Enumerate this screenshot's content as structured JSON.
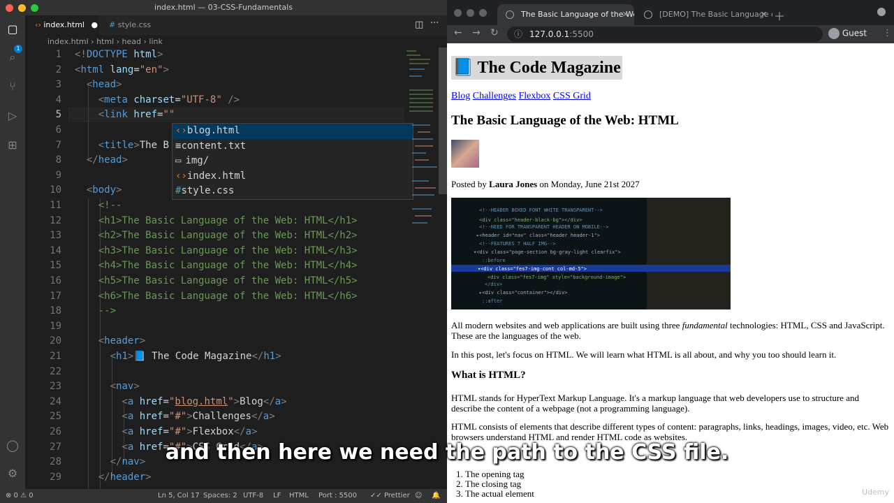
{
  "vscode": {
    "title": "index.html — 03-CSS-Fundamentals",
    "tabs": [
      {
        "label": "index.html",
        "modified": "●"
      },
      {
        "label": "style.css"
      }
    ],
    "breadcrumb": [
      "index.html",
      "html",
      "head",
      "link"
    ],
    "lines": [
      {
        "n": "1",
        "html": "<span class='p'>&lt;!</span><span class='k'>DOCTYPE</span> <span class='a'>html</span><span class='p'>&gt;</span>"
      },
      {
        "n": "2",
        "html": "<span class='p'>&lt;</span><span class='t'>html</span> <span class='a'>lang</span>=<span class='s'>\"en\"</span><span class='p'>&gt;</span>"
      },
      {
        "n": "3",
        "html": "  <span class='p'>&lt;</span><span class='t'>head</span><span class='p'>&gt;</span>"
      },
      {
        "n": "4",
        "html": "    <span class='p'>&lt;</span><span class='t'>meta</span> <span class='a'>charset</span>=<span class='s'>\"UTF-8\"</span> <span class='p'>/&gt;</span>"
      },
      {
        "n": "5",
        "html": "    <span class='p'>&lt;</span><span class='t'>link</span> <span class='a'>href</span>=<span class='s'>\"\"</span>"
      },
      {
        "n": "6",
        "html": ""
      },
      {
        "n": "7",
        "html": "    <span class='p'>&lt;</span><span class='t'>title</span><span class='p'>&gt;</span>The B"
      },
      {
        "n": "8",
        "html": "  <span class='p'>&lt;/</span><span class='t'>head</span><span class='p'>&gt;</span>"
      },
      {
        "n": "9",
        "html": ""
      },
      {
        "n": "10",
        "html": "  <span class='p'>&lt;</span><span class='t'>body</span><span class='p'>&gt;</span>"
      },
      {
        "n": "11",
        "html": "    <span class='c'>&lt;!--</span>"
      },
      {
        "n": "12",
        "html": "    <span class='c'>&lt;h1&gt;The Basic Language of the Web: HTML&lt;/h1&gt;</span>"
      },
      {
        "n": "13",
        "html": "    <span class='c'>&lt;h2&gt;The Basic Language of the Web: HTML&lt;/h2&gt;</span>"
      },
      {
        "n": "14",
        "html": "    <span class='c'>&lt;h3&gt;The Basic Language of the Web: HTML&lt;/h3&gt;</span>"
      },
      {
        "n": "15",
        "html": "    <span class='c'>&lt;h4&gt;The Basic Language of the Web: HTML&lt;/h4&gt;</span>"
      },
      {
        "n": "16",
        "html": "    <span class='c'>&lt;h5&gt;The Basic Language of the Web: HTML&lt;/h5&gt;</span>"
      },
      {
        "n": "17",
        "html": "    <span class='c'>&lt;h6&gt;The Basic Language of the Web: HTML&lt;/h6&gt;</span>"
      },
      {
        "n": "18",
        "html": "    <span class='c'>--&gt;</span>"
      },
      {
        "n": "19",
        "html": ""
      },
      {
        "n": "20",
        "html": "    <span class='p'>&lt;</span><span class='t'>header</span><span class='p'>&gt;</span>"
      },
      {
        "n": "21",
        "html": "      <span class='p'>&lt;</span><span class='t'>h1</span><span class='p'>&gt;</span>📘 The Code Magazine<span class='p'>&lt;/</span><span class='t'>h1</span><span class='p'>&gt;</span>"
      },
      {
        "n": "22",
        "html": ""
      },
      {
        "n": "23",
        "html": "      <span class='p'>&lt;</span><span class='t'>nav</span><span class='p'>&gt;</span>"
      },
      {
        "n": "24",
        "html": "        <span class='p'>&lt;</span><span class='t'>a</span> <span class='a'>href</span>=<span class='s'>\"<u>blog.html</u>\"</span><span class='p'>&gt;</span>Blog<span class='p'>&lt;/</span><span class='t'>a</span><span class='p'>&gt;</span>"
      },
      {
        "n": "25",
        "html": "        <span class='p'>&lt;</span><span class='t'>a</span> <span class='a'>href</span>=<span class='s'>\"#\"</span><span class='p'>&gt;</span>Challenges<span class='p'>&lt;/</span><span class='t'>a</span><span class='p'>&gt;</span>"
      },
      {
        "n": "26",
        "html": "        <span class='p'>&lt;</span><span class='t'>a</span> <span class='a'>href</span>=<span class='s'>\"#\"</span><span class='p'>&gt;</span>Flexbox<span class='p'>&lt;/</span><span class='t'>a</span><span class='p'>&gt;</span>"
      },
      {
        "n": "27",
        "html": "        <span class='p'>&lt;</span><span class='t'>a</span> <span class='a'>href</span>=<span class='s'>\"#\"</span><span class='p'>&gt;</span>CSS Grid<span class='p'>&lt;/</span><span class='t'>a</span><span class='p'>&gt;</span>"
      },
      {
        "n": "28",
        "html": "      <span class='p'>&lt;/</span><span class='t'>nav</span><span class='p'>&gt;</span>"
      },
      {
        "n": "29",
        "html": "    <span class='p'>&lt;/</span><span class='t'>header</span><span class='p'>&gt;</span>"
      }
    ],
    "suggestions": [
      {
        "icon": "‹›",
        "label": "blog.html"
      },
      {
        "icon": "≡",
        "label": "content.txt"
      },
      {
        "icon": "▭",
        "label": "img/"
      },
      {
        "icon": "‹›",
        "label": "index.html"
      },
      {
        "icon": "#",
        "label": "style.css"
      }
    ],
    "status": {
      "problems": "⊗ 0 ⚠ 0",
      "position": "Ln 5, Col 17",
      "spaces": "Spaces: 2",
      "encoding": "UTF-8",
      "eol": "LF",
      "language": "HTML",
      "port": "Port : 5500",
      "formatter": "Prettier"
    }
  },
  "browser": {
    "tabs": [
      "The Basic Language of the Web",
      "[DEMO] The Basic Language of"
    ],
    "url_host": "127.0.0.1",
    "url_port": ":5500",
    "profile": "Guest",
    "page": {
      "site_title": "The Code Magazine",
      "nav": [
        "Blog",
        "Challenges",
        "Flexbox",
        "CSS Grid"
      ],
      "post_title": "The Basic Language of the Web: HTML",
      "posted_prefix": "Posted by ",
      "author": "Laura Jones",
      "posted_suffix": " on Monday, June 21st 2027",
      "p1_a": "All modern websites and web applications are built using three ",
      "p1_em": "fundamental",
      "p1_b": " technologies: HTML, CSS and JavaScript. These are the languages of the web.",
      "p2": "In this post, let's focus on HTML. We will learn what HTML is all about, and why you too should learn it.",
      "h3": "What is HTML?",
      "p3": "HTML stands for HyperText Markup Language. It's a markup language that web developers use to structure and describe the content of a webpage (not a programming language).",
      "p4": "HTML consists of elements that describe different types of content: paragraphs, links, headings, images, video, etc. Web browsers understand HTML and render HTML code as websites.",
      "list": [
        "The opening tag",
        "The closing tag",
        "The actual element"
      ]
    }
  },
  "subtitle": "and then here we need the path to the CSS file.",
  "watermark": "Udemy"
}
